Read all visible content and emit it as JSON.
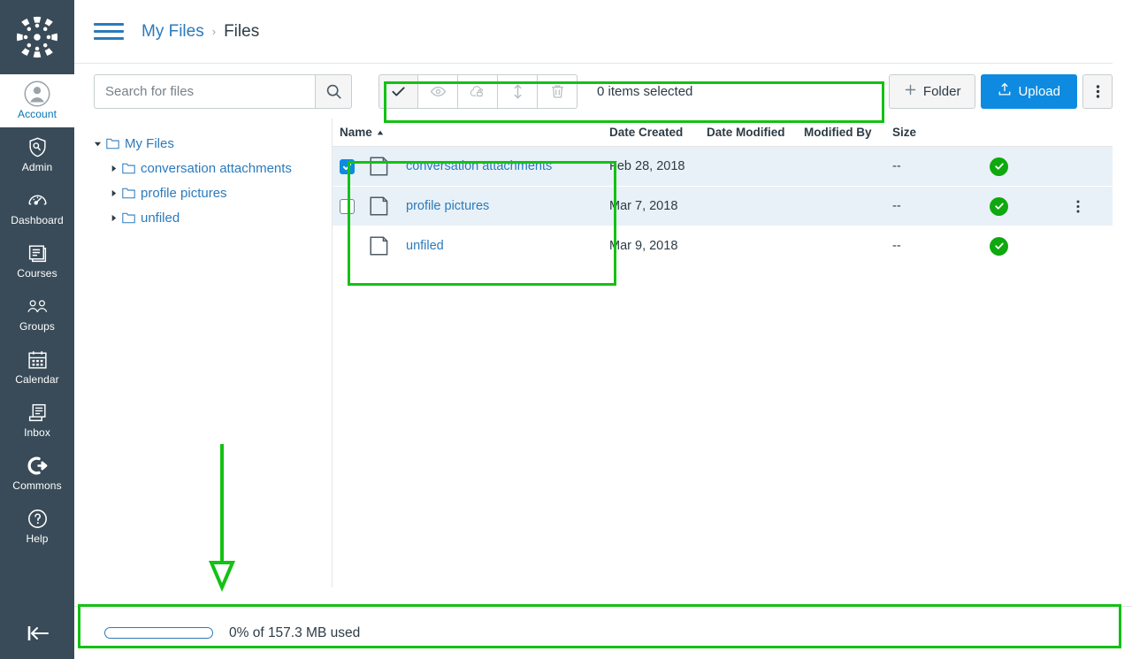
{
  "globalnav": {
    "logo_icon": "canvas-logo-icon",
    "items": [
      {
        "label": "Account",
        "icon": "user-avatar-icon",
        "active": true
      },
      {
        "label": "Admin",
        "icon": "shield-wrench-icon",
        "active": false
      },
      {
        "label": "Dashboard",
        "icon": "dashboard-gauge-icon",
        "active": false
      },
      {
        "label": "Courses",
        "icon": "book-icon",
        "active": false
      },
      {
        "label": "Groups",
        "icon": "people-group-icon",
        "active": false
      },
      {
        "label": "Calendar",
        "icon": "calendar-icon",
        "active": false
      },
      {
        "label": "Inbox",
        "icon": "inbox-tray-icon",
        "active": false
      },
      {
        "label": "Commons",
        "icon": "arrow-right-circle-icon",
        "active": false
      },
      {
        "label": "Help",
        "icon": "question-circle-icon",
        "active": false
      }
    ],
    "collapse_icon": "collapse-left-icon"
  },
  "header": {
    "menu_icon": "hamburger-menu-icon",
    "breadcrumb": {
      "parent": "My Files",
      "separator": "›",
      "current": "Files"
    }
  },
  "toolbar": {
    "search": {
      "placeholder": "Search for files",
      "value": "",
      "icon": "search-icon"
    },
    "actions": [
      {
        "name": "toggle-select-all",
        "icon": "checkmark-icon",
        "active": true
      },
      {
        "name": "view-button",
        "icon": "eye-icon",
        "active": false
      },
      {
        "name": "restrict-access-button",
        "icon": "cloud-lock-icon",
        "active": false
      },
      {
        "name": "move-button",
        "icon": "updown-arrow-icon",
        "active": false
      },
      {
        "name": "delete-button",
        "icon": "trash-icon",
        "active": false
      }
    ],
    "selection_status": "0 items selected",
    "folder_label": "Folder",
    "folder_icon": "plus-icon",
    "upload_label": "Upload",
    "upload_icon": "upload-arrow-icon",
    "more_icon": "kebab-vertical-icon",
    "primary_color": "#0E8BE0"
  },
  "tree": {
    "root": {
      "label": "My Files",
      "expanded": true,
      "caret_icon": "caret-down-icon",
      "folder_icon": "folder-icon"
    },
    "children": [
      {
        "label": "conversation attachments",
        "expanded": false,
        "caret_icon": "caret-right-icon",
        "folder_icon": "folder-icon"
      },
      {
        "label": "profile pictures",
        "expanded": false,
        "caret_icon": "caret-right-icon",
        "folder_icon": "folder-icon"
      },
      {
        "label": "unfiled",
        "expanded": false,
        "caret_icon": "caret-right-icon",
        "folder_icon": "folder-icon"
      }
    ]
  },
  "table": {
    "columns": {
      "name": "Name",
      "sort_icon": "sort-ascending-icon",
      "date_created": "Date Created",
      "date_modified": "Date Modified",
      "modified_by": "Modified By",
      "size": "Size"
    },
    "rows": [
      {
        "name": "conversation attachments",
        "date_created": "Feb 28, 2018",
        "date_modified": "",
        "modified_by": "",
        "size": "--",
        "checked": true,
        "checkbox_visible": true,
        "published": true,
        "published_icon": "published-check-icon",
        "kebab_visible": false,
        "shaded": true
      },
      {
        "name": "profile pictures",
        "date_created": "Mar 7, 2018",
        "date_modified": "",
        "modified_by": "",
        "size": "--",
        "checked": false,
        "checkbox_visible": true,
        "published": true,
        "published_icon": "published-check-icon",
        "kebab_visible": true,
        "shaded": true
      },
      {
        "name": "unfiled",
        "date_created": "Mar 9, 2018",
        "date_modified": "",
        "modified_by": "",
        "size": "--",
        "checked": false,
        "checkbox_visible": false,
        "published": true,
        "published_icon": "published-check-icon",
        "kebab_visible": false,
        "shaded": false
      }
    ]
  },
  "storage": {
    "label": "0% of 157.3 MB used",
    "percent": 0
  },
  "annotations": {
    "color": "#14C114",
    "boxes": [
      {
        "name": "toolbar-actions-highlight"
      },
      {
        "name": "file-list-names-highlight"
      },
      {
        "name": "storage-bar-highlight"
      }
    ],
    "arrow": {
      "name": "storage-pointer-arrow"
    }
  }
}
